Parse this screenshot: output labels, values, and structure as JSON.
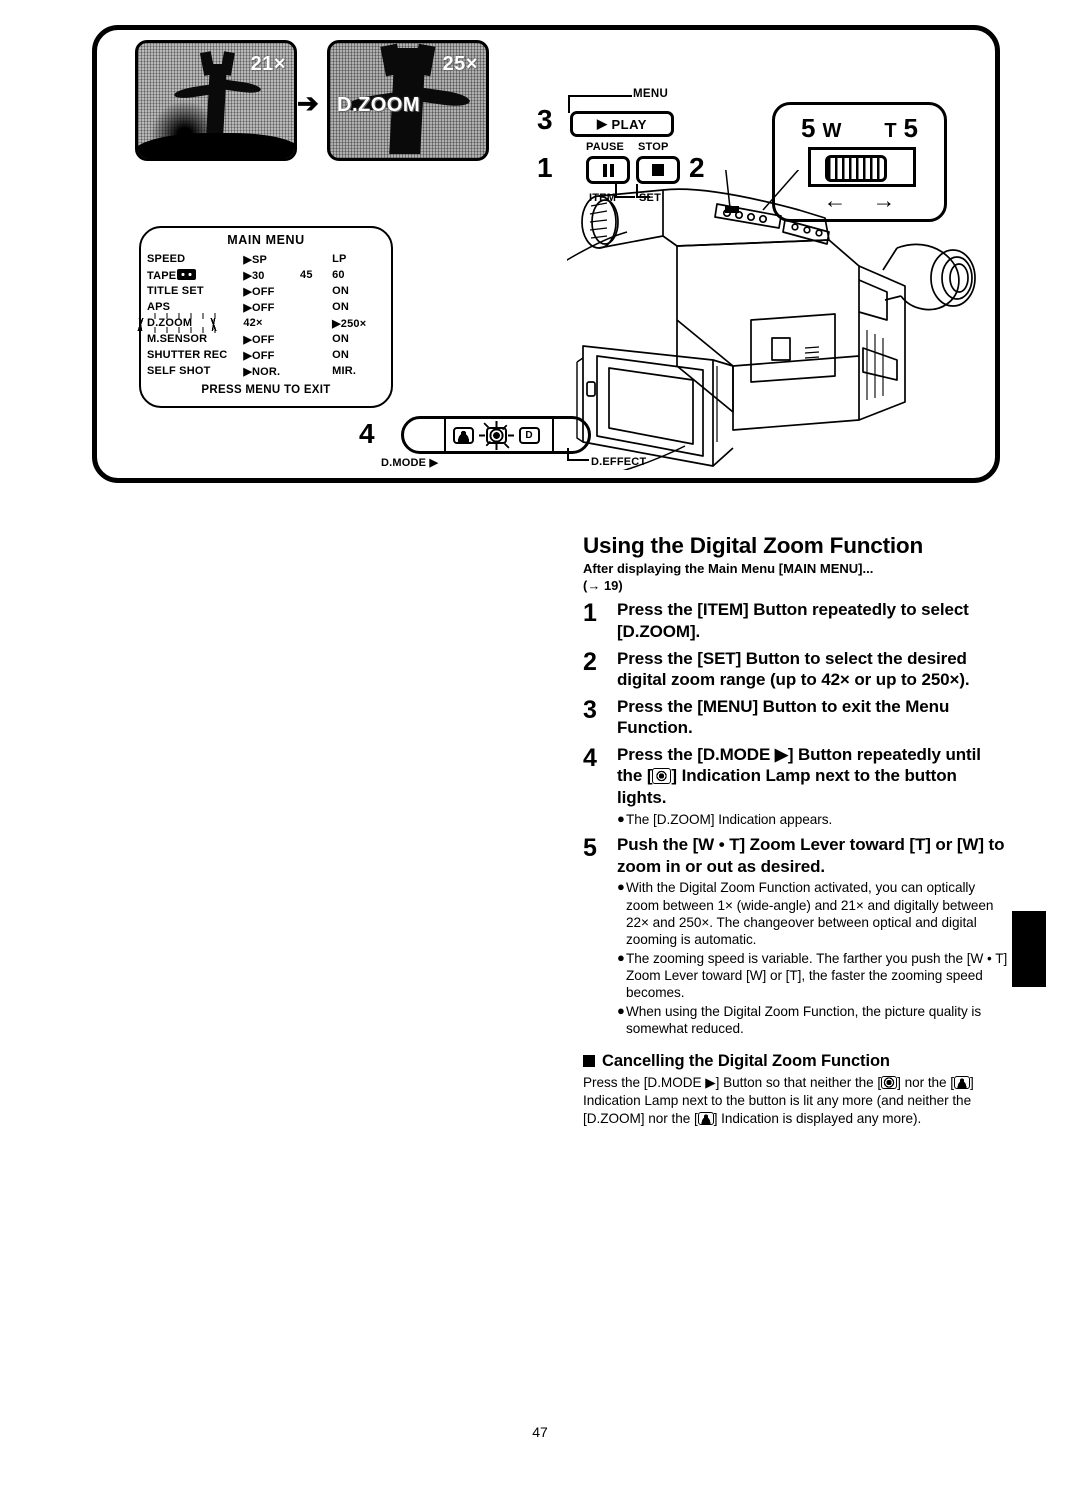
{
  "page": {
    "number": "47"
  },
  "illustration": {
    "thumbnails": [
      {
        "zoom_label": "21×",
        "overlay": ""
      },
      {
        "zoom_label": "25×",
        "overlay": "D.ZOOM"
      }
    ],
    "transition_arrow": "➔",
    "main_menu": {
      "title": "MAIN MENU",
      "footer": "PRESS MENU TO EXIT",
      "rows": [
        {
          "label": "SPEED",
          "c1": "▶SP",
          "c2": "",
          "c3": "LP",
          "highlight": false
        },
        {
          "label": "TAPE",
          "c1": "▶30",
          "c2": "45",
          "c3": "60",
          "highlight": false,
          "icon": "cassette-icon"
        },
        {
          "label": "TITLE SET",
          "c1": "▶OFF",
          "c2": "",
          "c3": "ON",
          "highlight": false
        },
        {
          "label": "APS",
          "c1": "▶OFF",
          "c2": "",
          "c3": "ON",
          "highlight": false
        },
        {
          "label": "D.ZOOM",
          "c1": "42×",
          "c2": "",
          "c3": "▶250×",
          "highlight": true
        },
        {
          "label": "M.SENSOR",
          "c1": "▶OFF",
          "c2": "",
          "c3": "ON",
          "highlight": false
        },
        {
          "label": "SHUTTER REC",
          "c1": "▶OFF",
          "c2": "",
          "c3": "ON",
          "highlight": false
        },
        {
          "label": "SELF SHOT",
          "c1": "▶NOR.",
          "c2": "",
          "c3": "MIR.",
          "highlight": false
        }
      ]
    },
    "button_callout": {
      "num_3": "3",
      "num_1": "1",
      "num_2": "2",
      "menu_label": "MENU",
      "play_label": "PLAY",
      "play_glyph": "▶",
      "pause_label": "PAUSE",
      "stop_label": "STOP",
      "item_label": "ITEM",
      "set_label": "SET"
    },
    "zoom_lever": {
      "left_num": "5",
      "w_label": "W",
      "t_label": "T",
      "right_num": "5",
      "arrow_left": "←",
      "arrow_right": "→"
    },
    "dmode": {
      "num_4": "4",
      "dmode_label": "D.MODE ▶",
      "deffect_label": "D.EFFECT",
      "lamp_d_label": "D"
    }
  },
  "main": {
    "title": "Using the Digital Zoom Function",
    "intro_line1": "After displaying the Main Menu [MAIN MENU]...",
    "intro_line2": "(→ 19)",
    "steps": [
      {
        "num": "1",
        "text": "Press the [ITEM] Button repeatedly to select [D.ZOOM].",
        "bullets": []
      },
      {
        "num": "2",
        "text": "Press the [SET] Button to select the desired digital zoom range (up to 42× or up to 250×).",
        "bullets": []
      },
      {
        "num": "3",
        "text": "Press the [MENU] Button to exit the Menu Function.",
        "bullets": []
      },
      {
        "num": "4",
        "text_before": "Press the [D.MODE ▶] Button repeatedly until the [",
        "text_after": "] Indication Lamp next to the button lights.",
        "bullets": [
          "The [D.ZOOM] Indication appears."
        ]
      },
      {
        "num": "5",
        "text": "Push the [W • T] Zoom Lever toward [T] or [W] to zoom in or out as desired.",
        "bullets": [
          "With the Digital Zoom Function activated, you can optically zoom between 1× (wide-angle) and 21× and digitally between 22× and 250×. The changeover between optical and digital zooming is automatic.",
          "The zooming speed is variable. The farther you push the [W • T] Zoom Lever toward [W] or [T], the faster the zooming speed becomes.",
          "When using the Digital Zoom Function, the picture quality is somewhat reduced."
        ]
      }
    ],
    "cancel_section": {
      "heading": "Cancelling the Digital Zoom Function",
      "body_p1": "Press the [D.MODE ▶] Button so that neither the [",
      "body_p2": "] nor the [",
      "body_p3": "] Indication Lamp next to the button is lit any more (and neither the [D.ZOOM] nor the [",
      "body_p4": "] Indication is displayed any more)."
    }
  }
}
